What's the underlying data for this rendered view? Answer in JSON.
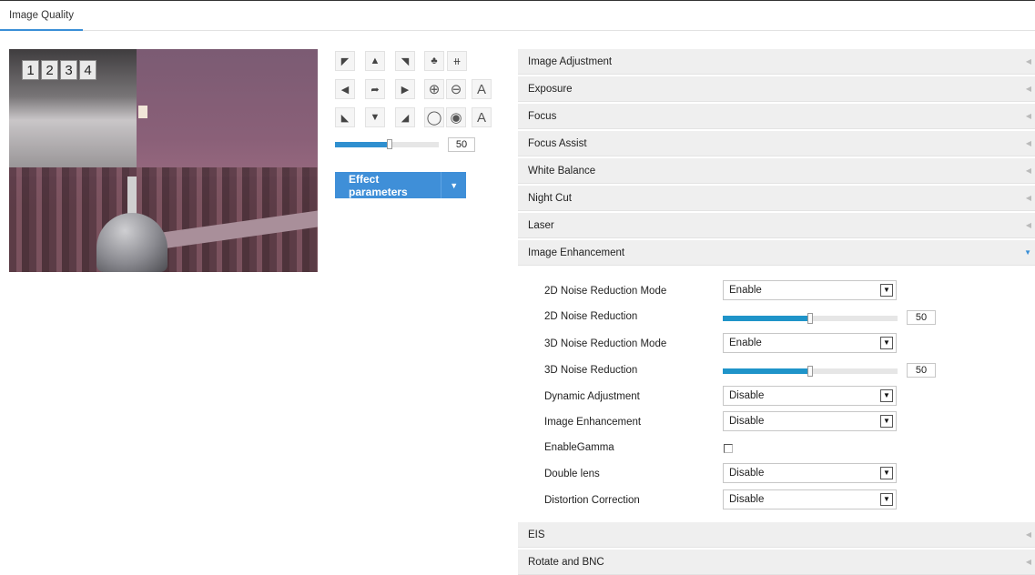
{
  "tab": {
    "label": "Image Quality"
  },
  "preview": {
    "channels": [
      "1",
      "2",
      "3",
      "4"
    ]
  },
  "ptz": {
    "zoom_value": "50",
    "zoom_fraction": 0.53,
    "effect_button": "Effect parameters",
    "buttons": [
      {
        "name": "pan-up-left-icon",
        "glyph": "◤"
      },
      {
        "name": "pan-up-icon",
        "glyph": "▲"
      },
      {
        "name": "pan-up-right-icon",
        "glyph": "◥"
      },
      {
        "name": "wiper-icon",
        "glyph": "♣"
      },
      {
        "name": "light-icon",
        "glyph": "⧺"
      },
      {
        "name": "pan-left-icon",
        "glyph": "◀"
      },
      {
        "name": "auto-pan-icon",
        "glyph": "➦"
      },
      {
        "name": "pan-right-icon",
        "glyph": "▶"
      },
      {
        "name": "zoom-in-icon",
        "glyph": "⊕"
      },
      {
        "name": "zoom-out-icon",
        "glyph": "⊖"
      },
      {
        "name": "focus-auto-icon",
        "glyph": "A"
      },
      {
        "name": "pan-down-left-icon",
        "glyph": "◣"
      },
      {
        "name": "pan-down-icon",
        "glyph": "▼"
      },
      {
        "name": "pan-down-right-icon",
        "glyph": "◢"
      },
      {
        "name": "iris-open-icon",
        "glyph": "◯"
      },
      {
        "name": "iris-close-icon",
        "glyph": "◉"
      },
      {
        "name": "iris-auto-icon",
        "glyph": "A"
      }
    ]
  },
  "sections": [
    "Image Adjustment",
    "Exposure",
    "Focus",
    "Focus Assist",
    "White Balance",
    "Night Cut",
    "Laser",
    "Image Enhancement",
    "EIS",
    "Rotate and BNC"
  ],
  "enhancement": {
    "nr2d_mode_label": "2D Noise Reduction Mode",
    "nr2d_mode_value": "Enable",
    "nr2d_label": "2D Noise Reduction",
    "nr2d_value": "50",
    "nr2d_fraction": 0.5,
    "nr3d_mode_label": "3D Noise Reduction Mode",
    "nr3d_mode_value": "Enable",
    "nr3d_label": "3D Noise Reduction",
    "nr3d_value": "50",
    "nr3d_fraction": 0.5,
    "dynamic_label": "Dynamic Adjustment",
    "dynamic_value": "Disable",
    "enhance_label": "Image Enhancement",
    "enhance_value": "Disable",
    "gamma_label": "EnableGamma",
    "gamma_checked": false,
    "double_lens_label": "Double lens",
    "double_lens_value": "Disable",
    "distortion_label": "Distortion Correction",
    "distortion_value": "Disable"
  },
  "colors": {
    "accent": "#3f8fd8",
    "slider": "#1f94c9"
  }
}
